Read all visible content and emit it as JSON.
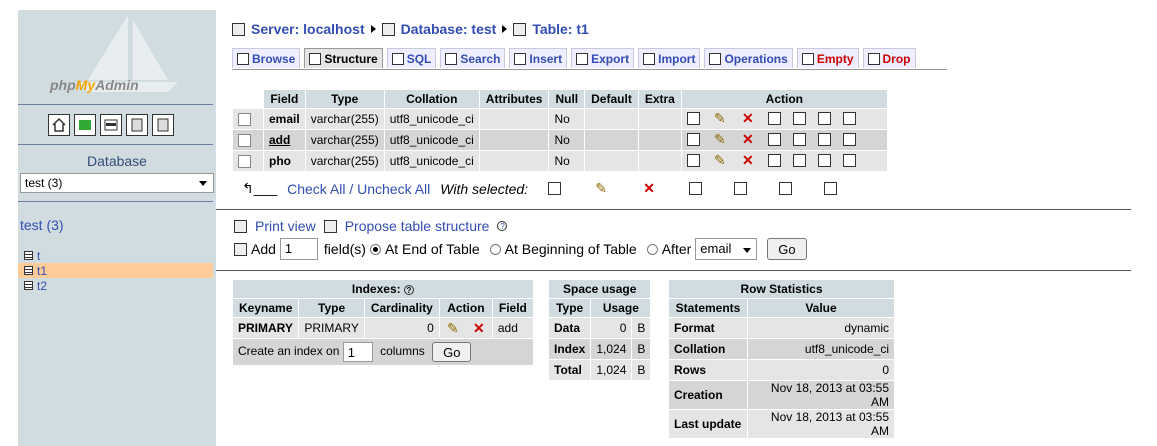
{
  "app": {
    "logo_php": "php",
    "logo_my": "My",
    "logo_admin": "Admin"
  },
  "sidebar": {
    "db_label": "Database",
    "db_selected": "test (3)",
    "db_name": "test (3)",
    "tables": [
      {
        "name": "t"
      },
      {
        "name": "t1"
      },
      {
        "name": "t2"
      }
    ]
  },
  "breadcrumb": {
    "server": "Server: localhost",
    "database": "Database: test",
    "table": "Table: t1"
  },
  "tabs": [
    {
      "label": "Browse"
    },
    {
      "label": "Structure"
    },
    {
      "label": "SQL"
    },
    {
      "label": "Search"
    },
    {
      "label": "Insert"
    },
    {
      "label": "Export"
    },
    {
      "label": "Import"
    },
    {
      "label": "Operations"
    },
    {
      "label": "Empty"
    },
    {
      "label": "Drop"
    }
  ],
  "structure": {
    "headers": [
      "Field",
      "Type",
      "Collation",
      "Attributes",
      "Null",
      "Default",
      "Extra",
      "Action"
    ],
    "rows": [
      {
        "field": "email",
        "type": "varchar(255)",
        "collation": "utf8_unicode_ci",
        "attributes": "",
        "null": "No",
        "default": "",
        "extra": ""
      },
      {
        "field": "add",
        "type": "varchar(255)",
        "collation": "utf8_unicode_ci",
        "attributes": "",
        "null": "No",
        "default": "",
        "extra": ""
      },
      {
        "field": "pho",
        "type": "varchar(255)",
        "collation": "utf8_unicode_ci",
        "attributes": "",
        "null": "No",
        "default": "",
        "extra": ""
      }
    ],
    "check_all": "Check All / Uncheck All",
    "with_selected": "With selected:"
  },
  "print": {
    "print_view": "Print view",
    "propose": "Propose table structure"
  },
  "add_field": {
    "add_label": "Add",
    "count": "1",
    "fields_label": "field(s)",
    "at_end": "At End of Table",
    "at_begin": "At Beginning of Table",
    "after": "After",
    "after_field": "email",
    "go": "Go"
  },
  "indexes": {
    "title": "Indexes:",
    "headers": [
      "Keyname",
      "Type",
      "Cardinality",
      "Action",
      "Field"
    ],
    "rows": [
      {
        "keyname": "PRIMARY",
        "type": "PRIMARY",
        "cardinality": "0",
        "field": "add"
      }
    ],
    "create_label": "Create an index on",
    "create_count": "1",
    "columns_label": "columns",
    "go": "Go"
  },
  "space": {
    "title": "Space usage",
    "headers": [
      "Type",
      "Usage"
    ],
    "rows": [
      {
        "type": "Data",
        "usage": "0",
        "unit": "B"
      },
      {
        "type": "Index",
        "usage": "1,024",
        "unit": "B"
      },
      {
        "type": "Total",
        "usage": "1,024",
        "unit": "B"
      }
    ]
  },
  "rowstats": {
    "title": "Row Statistics",
    "headers": [
      "Statements",
      "Value"
    ],
    "rows": [
      {
        "statement": "Format",
        "value": "dynamic"
      },
      {
        "statement": "Collation",
        "value": "utf8_unicode_ci"
      },
      {
        "statement": "Rows",
        "value": "0"
      },
      {
        "statement": "Creation",
        "value": "Nov 18, 2013 at 03:55 AM"
      },
      {
        "statement": "Last update",
        "value": "Nov 18, 2013 at 03:55 AM"
      }
    ]
  },
  "colors": {
    "sidebar_bg": "#d0dce0",
    "link": "#334db3",
    "header_bg": "#d0dce0",
    "row_even": "#e5e5e5",
    "row_odd": "#d5d5d5",
    "highlight": "#ffcc99",
    "danger": "#cc0000"
  }
}
